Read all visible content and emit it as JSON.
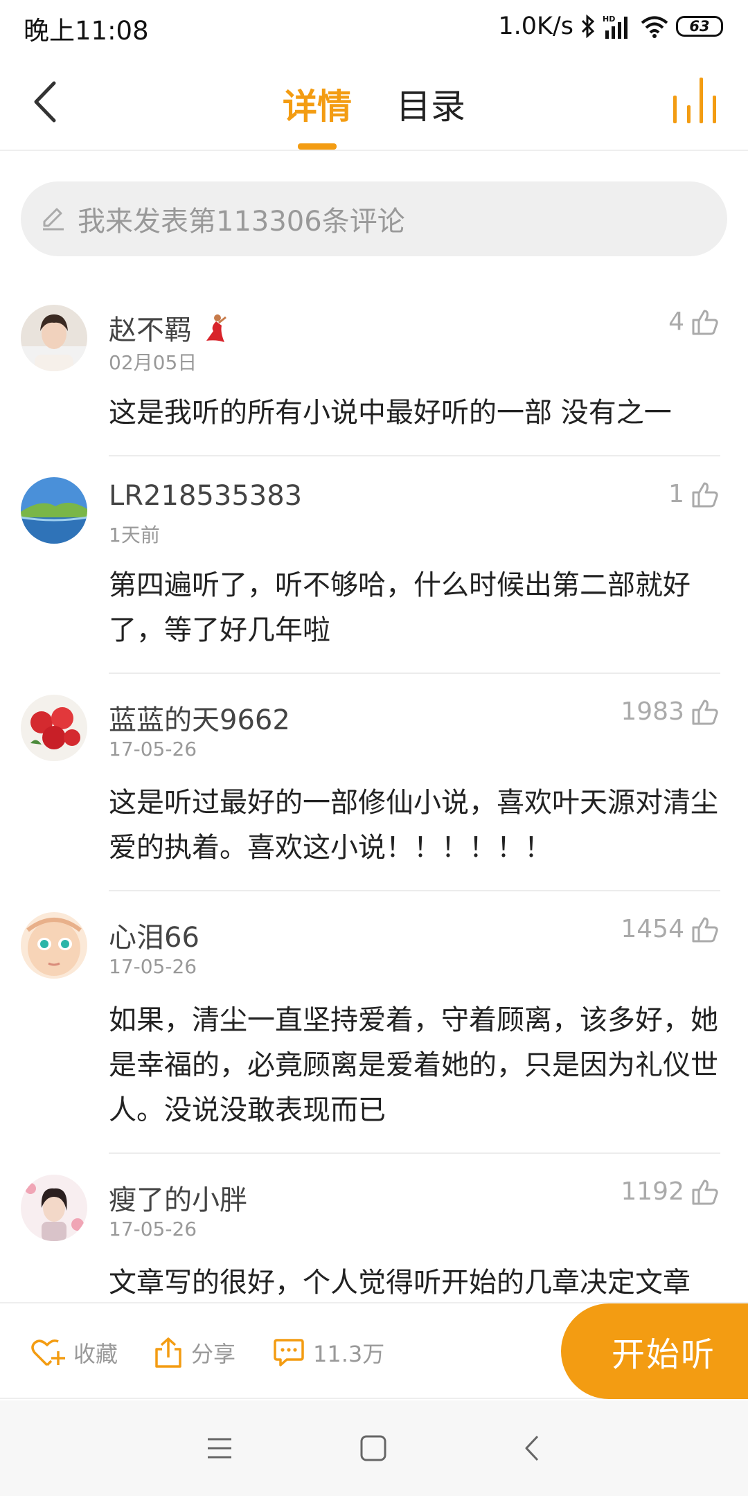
{
  "status_bar": {
    "time": "晚上11:08",
    "net_speed": "1.0K/s",
    "battery": "63"
  },
  "nav": {
    "tab_detail": "详情",
    "tab_catalog": "目录"
  },
  "comment_input": {
    "placeholder": "我来发表第113306条评论"
  },
  "comments": [
    {
      "name": "赵不羁",
      "date": "02月05日",
      "likes": "4",
      "text": "这是我听的所有小说中最好听的一部 没有之一"
    },
    {
      "name": "LR218535383",
      "date": "1天前",
      "likes": "1",
      "text": "第四遍听了，听不够哈，什么时候出第二部就好了，等了好几年啦"
    },
    {
      "name": "蓝蓝的天9662",
      "date": "17-05-26",
      "likes": "1983",
      "text": "这是听过最好的一部修仙小说，喜欢叶天源对清尘爱的执着。喜欢这小说！！！！！！"
    },
    {
      "name": "心泪66",
      "date": "17-05-26",
      "likes": "1454",
      "text": "如果，清尘一直坚持爱着，守着顾离，该多好，她是幸福的，必竟顾离是爱着她的，只是因为礼仪世人。没说没敢表现而已"
    },
    {
      "name": "瘦了的小胖",
      "date": "17-05-26",
      "likes": "1192",
      "text": "文章写的很好，个人觉得听开始的几章决定文章"
    }
  ],
  "action_bar": {
    "favorite": "收藏",
    "share": "分享",
    "comment_count": "11.3万",
    "listen": "开始听"
  },
  "colors": {
    "accent": "#f39c12",
    "text": "#222222",
    "muted": "#999999"
  }
}
